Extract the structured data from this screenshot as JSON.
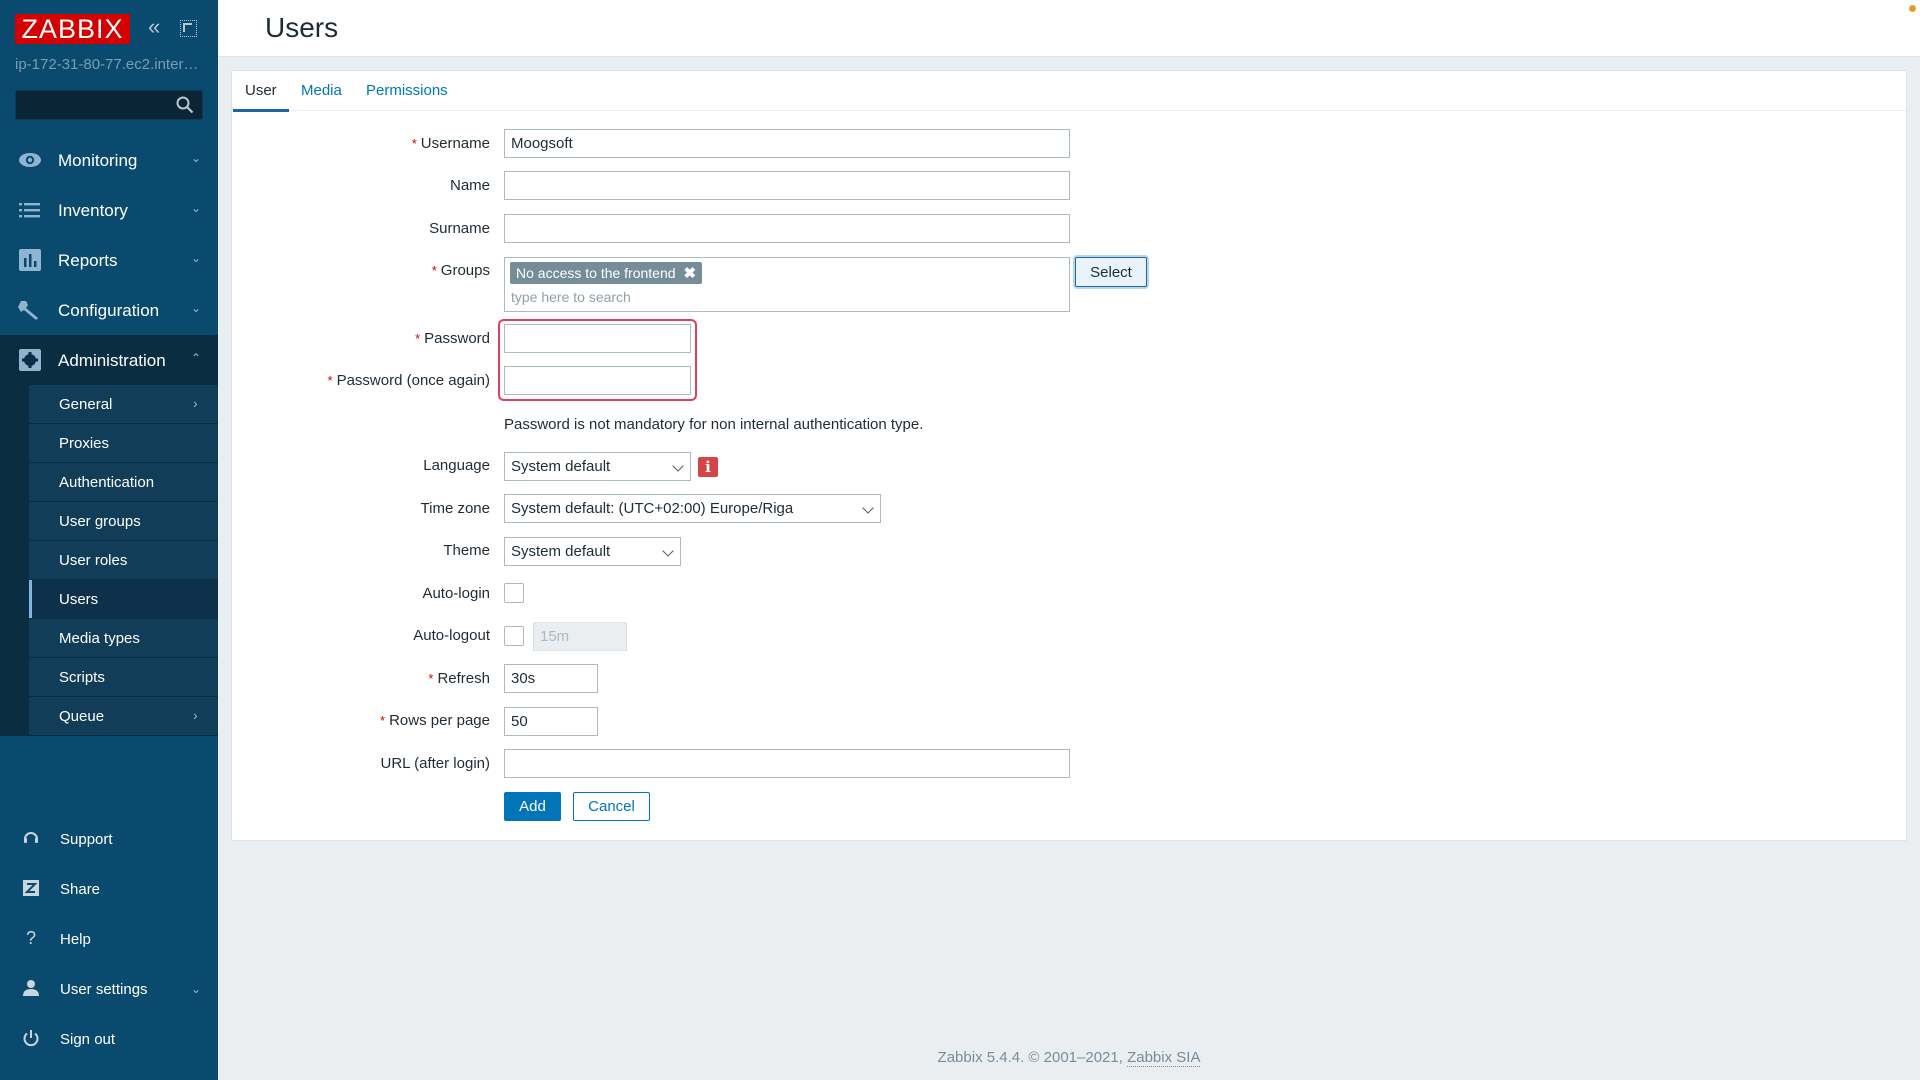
{
  "app": {
    "logo": "ZABBIX",
    "server_name": "ip-172-31-80-77.ec2.inter…",
    "search_placeholder": ""
  },
  "sidebar": {
    "menu": [
      {
        "label": "Monitoring",
        "icon": "eye-icon"
      },
      {
        "label": "Inventory",
        "icon": "list-icon"
      },
      {
        "label": "Reports",
        "icon": "bar-chart-icon"
      },
      {
        "label": "Configuration",
        "icon": "wrench-icon"
      },
      {
        "label": "Administration",
        "icon": "gear-icon",
        "expanded": true
      }
    ],
    "admin_items": [
      {
        "label": "General",
        "has_submenu": true
      },
      {
        "label": "Proxies"
      },
      {
        "label": "Authentication"
      },
      {
        "label": "User groups"
      },
      {
        "label": "User roles"
      },
      {
        "label": "Users",
        "selected": true
      },
      {
        "label": "Media types"
      },
      {
        "label": "Scripts"
      },
      {
        "label": "Queue",
        "has_submenu": true
      }
    ],
    "bottom": [
      {
        "label": "Support",
        "icon": "headset-icon"
      },
      {
        "label": "Share",
        "icon": "share-z-icon"
      },
      {
        "label": "Help",
        "icon": "question-icon"
      },
      {
        "label": "User settings",
        "icon": "user-icon"
      },
      {
        "label": "Sign out",
        "icon": "power-icon"
      }
    ]
  },
  "header": {
    "title": "Users"
  },
  "tabs": [
    {
      "label": "User",
      "active": true
    },
    {
      "label": "Media"
    },
    {
      "label": "Permissions"
    }
  ],
  "form": {
    "username": {
      "label": "Username",
      "required": true,
      "value": "Moogsoft"
    },
    "name": {
      "label": "Name",
      "value": ""
    },
    "surname": {
      "label": "Surname",
      "value": ""
    },
    "groups": {
      "label": "Groups",
      "required": true,
      "selected": [
        "No access to the frontend"
      ],
      "placeholder": "type here to search",
      "select_button": "Select"
    },
    "password": {
      "label": "Password",
      "required": true,
      "value": ""
    },
    "password_again": {
      "label": "Password (once again)",
      "required": true,
      "value": ""
    },
    "password_note": "Password is not mandatory for non internal authentication type.",
    "language": {
      "label": "Language",
      "value": "System default"
    },
    "timezone": {
      "label": "Time zone",
      "value": "System default: (UTC+02:00) Europe/Riga"
    },
    "theme": {
      "label": "Theme",
      "value": "System default"
    },
    "autologin": {
      "label": "Auto-login",
      "checked": false
    },
    "autologout": {
      "label": "Auto-logout",
      "checked": false,
      "value": "15m"
    },
    "refresh": {
      "label": "Refresh",
      "required": true,
      "value": "30s"
    },
    "rows_per_page": {
      "label": "Rows per page",
      "required": true,
      "value": "50"
    },
    "url": {
      "label": "URL (after login)",
      "value": ""
    },
    "add_button": "Add",
    "cancel_button": "Cancel"
  },
  "footer": {
    "text": "Zabbix 5.4.4. © 2001–2021, ",
    "link": "Zabbix SIA"
  },
  "colors": {
    "sidebar_bg": "#0b4a6f",
    "logo_red": "#d40000",
    "primary_blue": "#0275b8",
    "error_border": "#e0405a",
    "required_star": "#d40000"
  }
}
